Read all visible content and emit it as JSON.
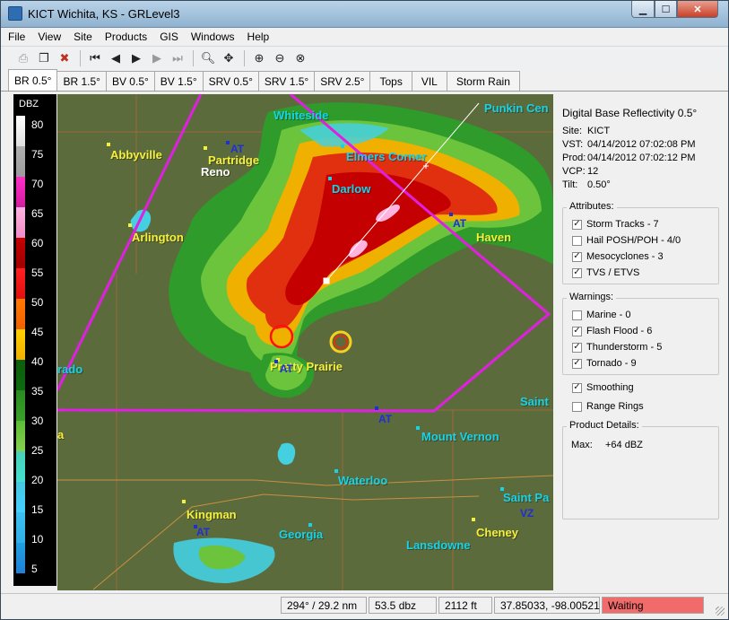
{
  "window": {
    "title": "KICT Wichita, KS - GRLevel3",
    "min_icon": "minimize-icon",
    "max_icon": "maximize-icon",
    "close_icon": "close-icon"
  },
  "menu": [
    "File",
    "View",
    "Site",
    "Products",
    "GIS",
    "Windows",
    "Help"
  ],
  "tabs": [
    "BR 0.5°",
    "BR 1.5°",
    "BV 0.5°",
    "BV 1.5°",
    "SRV 0.5°",
    "SRV 1.5°",
    "SRV 2.5°",
    "Tops",
    "VIL",
    "Storm Rain"
  ],
  "active_tab": "BR 0.5°",
  "colorbar": {
    "unit": "DBZ",
    "ticks": [
      "80",
      "75",
      "70",
      "65",
      "60",
      "55",
      "50",
      "45",
      "40",
      "35",
      "30",
      "25",
      "20",
      "15",
      "10",
      "5"
    ]
  },
  "map": {
    "cities": [
      {
        "name": "Whiteside",
        "color": "cyan"
      },
      {
        "name": "Punkin Cen",
        "color": "cyan"
      },
      {
        "name": "Abbyville",
        "color": "yellow"
      },
      {
        "name": "Partridge",
        "color": "yellow"
      },
      {
        "name": "Reno",
        "color": "white"
      },
      {
        "name": "Elmers Corner",
        "color": "cyan"
      },
      {
        "name": "Darlow",
        "color": "cyan"
      },
      {
        "name": "Arlington",
        "color": "yellow"
      },
      {
        "name": "Haven",
        "color": "yellow"
      },
      {
        "name": "rado",
        "color": "cyan"
      },
      {
        "name": "Pretty Prairie",
        "color": "yellow"
      },
      {
        "name": "Saint",
        "color": "cyan"
      },
      {
        "name": "Mount Vernon",
        "color": "cyan"
      },
      {
        "name": "Waterloo",
        "color": "cyan"
      },
      {
        "name": "Kingman",
        "color": "yellow"
      },
      {
        "name": "Saint Pa",
        "color": "cyan"
      },
      {
        "name": "Georgia",
        "color": "cyan"
      },
      {
        "name": "Cheney",
        "color": "yellow"
      },
      {
        "name": "Lansdowne",
        "color": "cyan"
      },
      {
        "name": "a",
        "color": "yellow"
      }
    ],
    "station_markers": [
      "AT",
      "AT",
      "AT",
      "AT",
      "AT",
      "VZ"
    ]
  },
  "panel": {
    "product": "Digital Base Reflectivity 0.5°",
    "site_label": "Site:",
    "site": "KICT",
    "vst_label": "VST:",
    "vst": "04/14/2012  07:02:08 PM",
    "prod_label": "Prod:",
    "prod": "04/14/2012  07:02:12 PM",
    "vcp_label": "VCP:",
    "vcp": "12",
    "tilt_label": "Tilt:",
    "tilt": "0.50°",
    "attributes_title": "Attributes:",
    "attributes": [
      {
        "label": "Storm Tracks - 7",
        "checked": true
      },
      {
        "label": "Hail POSH/POH - 4/0",
        "checked": false
      },
      {
        "label": "Mesocyclones - 3",
        "checked": true
      },
      {
        "label": "TVS / ETVS",
        "checked": true
      }
    ],
    "warnings_title": "Warnings:",
    "warnings": [
      {
        "label": "Marine - 0",
        "checked": false
      },
      {
        "label": "Flash Flood - 6",
        "checked": true
      },
      {
        "label": "Thunderstorm - 5",
        "checked": true
      },
      {
        "label": "Tornado - 9",
        "checked": true
      }
    ],
    "smoothing": {
      "label": "Smoothing",
      "checked": true
    },
    "range_rings": {
      "label": "Range Rings",
      "checked": false
    },
    "details_title": "Product Details:",
    "max_label": "Max:",
    "max_value": "+64 dBZ"
  },
  "status": {
    "azimuth": "294° / 29.2 nm",
    "value": "53.5 dbz",
    "height": "2112 ft",
    "coords": "37.85033, -98.00521",
    "state": "Waiting"
  },
  "colors": {
    "status_waiting": "#f26b6b",
    "warning_polygon": "#e020e0",
    "city_cyan": "#17d3e8",
    "city_yellow": "#f5f03a"
  }
}
